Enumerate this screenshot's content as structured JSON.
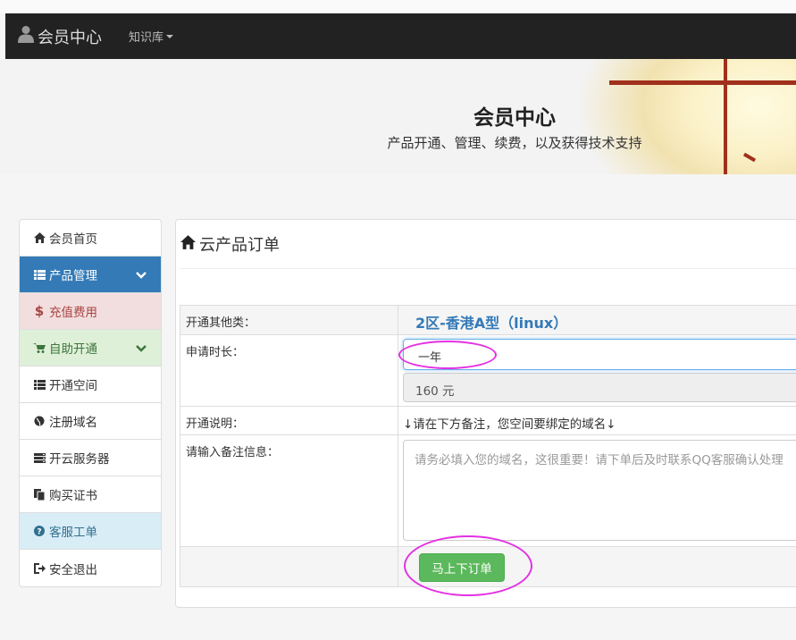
{
  "navbar": {
    "brand": "会员中心",
    "knowledge_menu": "知识库"
  },
  "hero": {
    "title": "会员中心",
    "subtitle": "产品开通、管理、续费，以及获得技术支持"
  },
  "sidebar": {
    "items": [
      {
        "label": "会员首页",
        "icon": "home-icon",
        "state": "default"
      },
      {
        "label": "产品管理",
        "icon": "list-icon",
        "state": "active",
        "expandable": true
      },
      {
        "label": "充值费用",
        "icon": "dollar-icon",
        "state": "danger"
      },
      {
        "label": "自助开通",
        "icon": "cart-icon",
        "state": "success",
        "expandable": true
      },
      {
        "label": "开通空间",
        "icon": "list-icon",
        "state": "default"
      },
      {
        "label": "注册域名",
        "icon": "globe-icon",
        "state": "default"
      },
      {
        "label": "开云服务器",
        "icon": "server-icon",
        "state": "default"
      },
      {
        "label": "购买证书",
        "icon": "certificate-icon",
        "state": "default"
      },
      {
        "label": "客服工单",
        "icon": "question-icon",
        "state": "info"
      },
      {
        "label": "安全退出",
        "icon": "logout-icon",
        "state": "default"
      }
    ]
  },
  "panel": {
    "title": "云产品订单"
  },
  "form": {
    "product_label": "开通其他类：",
    "product_value": "2区-香港A型（linux）",
    "duration_label": "申请时长：",
    "duration_value": "一年",
    "price": "160 元",
    "note_label": "开通说明：",
    "note_text": "↓请在下方备注，您空间要绑定的域名↓",
    "remark_label": "请输入备注信息：",
    "remark_placeholder": "请务必填入您的域名，这很重要！请下单后及时联系QQ客服确认处理",
    "submit_label": "马上下订单"
  },
  "colors": {
    "navbar": "#222222",
    "primary": "#337ab7",
    "success_button": "#5cb85c",
    "annotation_ring": "#e331e3"
  }
}
